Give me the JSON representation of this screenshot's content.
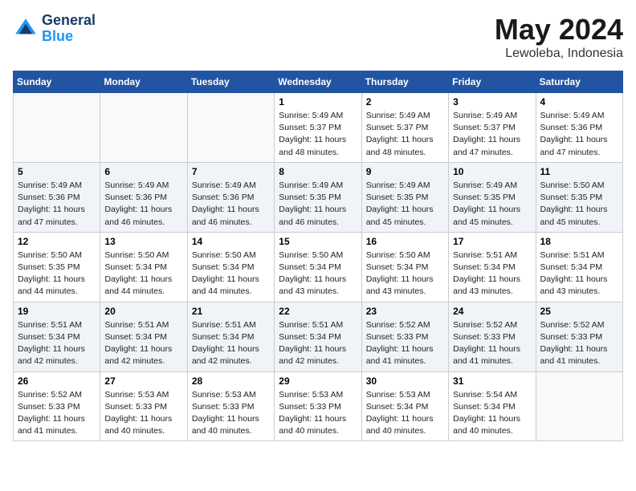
{
  "header": {
    "logo_line1": "General",
    "logo_line2": "Blue",
    "month": "May 2024",
    "location": "Lewoleba, Indonesia"
  },
  "weekdays": [
    "Sunday",
    "Monday",
    "Tuesday",
    "Wednesday",
    "Thursday",
    "Friday",
    "Saturday"
  ],
  "weeks": [
    [
      {
        "day": "",
        "info": ""
      },
      {
        "day": "",
        "info": ""
      },
      {
        "day": "",
        "info": ""
      },
      {
        "day": "1",
        "info": "Sunrise: 5:49 AM\nSunset: 5:37 PM\nDaylight: 11 hours\nand 48 minutes."
      },
      {
        "day": "2",
        "info": "Sunrise: 5:49 AM\nSunset: 5:37 PM\nDaylight: 11 hours\nand 48 minutes."
      },
      {
        "day": "3",
        "info": "Sunrise: 5:49 AM\nSunset: 5:37 PM\nDaylight: 11 hours\nand 47 minutes."
      },
      {
        "day": "4",
        "info": "Sunrise: 5:49 AM\nSunset: 5:36 PM\nDaylight: 11 hours\nand 47 minutes."
      }
    ],
    [
      {
        "day": "5",
        "info": "Sunrise: 5:49 AM\nSunset: 5:36 PM\nDaylight: 11 hours\nand 47 minutes."
      },
      {
        "day": "6",
        "info": "Sunrise: 5:49 AM\nSunset: 5:36 PM\nDaylight: 11 hours\nand 46 minutes."
      },
      {
        "day": "7",
        "info": "Sunrise: 5:49 AM\nSunset: 5:36 PM\nDaylight: 11 hours\nand 46 minutes."
      },
      {
        "day": "8",
        "info": "Sunrise: 5:49 AM\nSunset: 5:35 PM\nDaylight: 11 hours\nand 46 minutes."
      },
      {
        "day": "9",
        "info": "Sunrise: 5:49 AM\nSunset: 5:35 PM\nDaylight: 11 hours\nand 45 minutes."
      },
      {
        "day": "10",
        "info": "Sunrise: 5:49 AM\nSunset: 5:35 PM\nDaylight: 11 hours\nand 45 minutes."
      },
      {
        "day": "11",
        "info": "Sunrise: 5:50 AM\nSunset: 5:35 PM\nDaylight: 11 hours\nand 45 minutes."
      }
    ],
    [
      {
        "day": "12",
        "info": "Sunrise: 5:50 AM\nSunset: 5:35 PM\nDaylight: 11 hours\nand 44 minutes."
      },
      {
        "day": "13",
        "info": "Sunrise: 5:50 AM\nSunset: 5:34 PM\nDaylight: 11 hours\nand 44 minutes."
      },
      {
        "day": "14",
        "info": "Sunrise: 5:50 AM\nSunset: 5:34 PM\nDaylight: 11 hours\nand 44 minutes."
      },
      {
        "day": "15",
        "info": "Sunrise: 5:50 AM\nSunset: 5:34 PM\nDaylight: 11 hours\nand 43 minutes."
      },
      {
        "day": "16",
        "info": "Sunrise: 5:50 AM\nSunset: 5:34 PM\nDaylight: 11 hours\nand 43 minutes."
      },
      {
        "day": "17",
        "info": "Sunrise: 5:51 AM\nSunset: 5:34 PM\nDaylight: 11 hours\nand 43 minutes."
      },
      {
        "day": "18",
        "info": "Sunrise: 5:51 AM\nSunset: 5:34 PM\nDaylight: 11 hours\nand 43 minutes."
      }
    ],
    [
      {
        "day": "19",
        "info": "Sunrise: 5:51 AM\nSunset: 5:34 PM\nDaylight: 11 hours\nand 42 minutes."
      },
      {
        "day": "20",
        "info": "Sunrise: 5:51 AM\nSunset: 5:34 PM\nDaylight: 11 hours\nand 42 minutes."
      },
      {
        "day": "21",
        "info": "Sunrise: 5:51 AM\nSunset: 5:34 PM\nDaylight: 11 hours\nand 42 minutes."
      },
      {
        "day": "22",
        "info": "Sunrise: 5:51 AM\nSunset: 5:34 PM\nDaylight: 11 hours\nand 42 minutes."
      },
      {
        "day": "23",
        "info": "Sunrise: 5:52 AM\nSunset: 5:33 PM\nDaylight: 11 hours\nand 41 minutes."
      },
      {
        "day": "24",
        "info": "Sunrise: 5:52 AM\nSunset: 5:33 PM\nDaylight: 11 hours\nand 41 minutes."
      },
      {
        "day": "25",
        "info": "Sunrise: 5:52 AM\nSunset: 5:33 PM\nDaylight: 11 hours\nand 41 minutes."
      }
    ],
    [
      {
        "day": "26",
        "info": "Sunrise: 5:52 AM\nSunset: 5:33 PM\nDaylight: 11 hours\nand 41 minutes."
      },
      {
        "day": "27",
        "info": "Sunrise: 5:53 AM\nSunset: 5:33 PM\nDaylight: 11 hours\nand 40 minutes."
      },
      {
        "day": "28",
        "info": "Sunrise: 5:53 AM\nSunset: 5:33 PM\nDaylight: 11 hours\nand 40 minutes."
      },
      {
        "day": "29",
        "info": "Sunrise: 5:53 AM\nSunset: 5:33 PM\nDaylight: 11 hours\nand 40 minutes."
      },
      {
        "day": "30",
        "info": "Sunrise: 5:53 AM\nSunset: 5:34 PM\nDaylight: 11 hours\nand 40 minutes."
      },
      {
        "day": "31",
        "info": "Sunrise: 5:54 AM\nSunset: 5:34 PM\nDaylight: 11 hours\nand 40 minutes."
      },
      {
        "day": "",
        "info": ""
      }
    ]
  ]
}
